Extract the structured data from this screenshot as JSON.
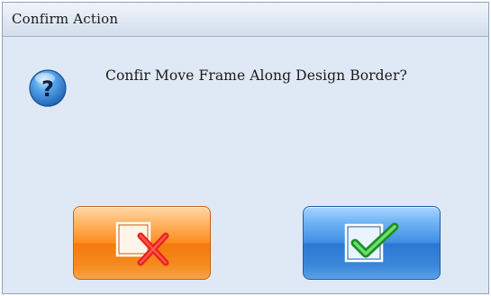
{
  "window": {
    "title": "Confirm Action"
  },
  "dialog": {
    "message": "Confir Move Frame Along Design Border?",
    "icon": "question-icon"
  },
  "buttons": {
    "cancel": {
      "icon": "cancel-x-icon"
    },
    "confirm": {
      "icon": "confirm-check-icon"
    }
  },
  "colors": {
    "background": "#dfe9f5",
    "cancel_button": "#f58a1e",
    "confirm_button": "#3a86da",
    "question_icon": "#2f7fd6"
  }
}
